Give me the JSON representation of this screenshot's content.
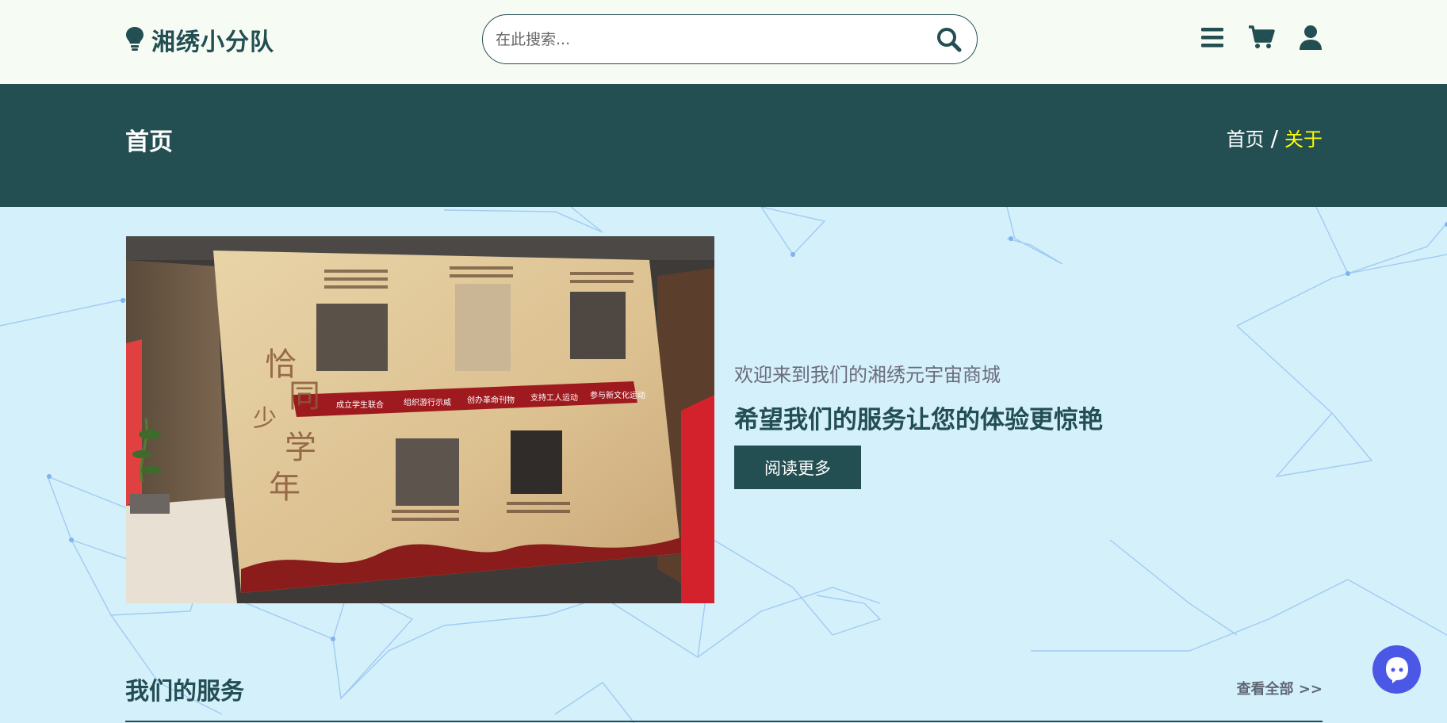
{
  "header": {
    "logo_icon": "lightbulb-icon",
    "logo_text": "湘绣小分队",
    "search": {
      "placeholder": "在此搜索...",
      "value": "",
      "icon": "search-icon"
    },
    "icons": [
      "menu-icon",
      "cart-icon",
      "user-icon"
    ]
  },
  "banner": {
    "title": "首页",
    "breadcrumb": {
      "home": "首页",
      "separator": "/",
      "current": "关于"
    }
  },
  "hero": {
    "image_label": "恰同学少年",
    "timeline": [
      "成立学生联合",
      "组织游行示威",
      "创办革命刊物",
      "支持工人运动",
      "参与新文化运动"
    ],
    "welcome": "欢迎来到我们的湘绣元宇宙商城",
    "headline": "希望我们的服务让您的体验更惊艳",
    "button": "阅读更多"
  },
  "services": {
    "title": "我们的服务",
    "view_all": "查看全部 >>"
  },
  "chat": {
    "icon": "chat-bot-icon"
  },
  "colors": {
    "primary": "#234e52",
    "header_bg": "#f6fbf4",
    "page_bg": "#d4f0fb",
    "breadcrumb_active": "#ffff00",
    "chat_bg": "#4b58e6"
  }
}
